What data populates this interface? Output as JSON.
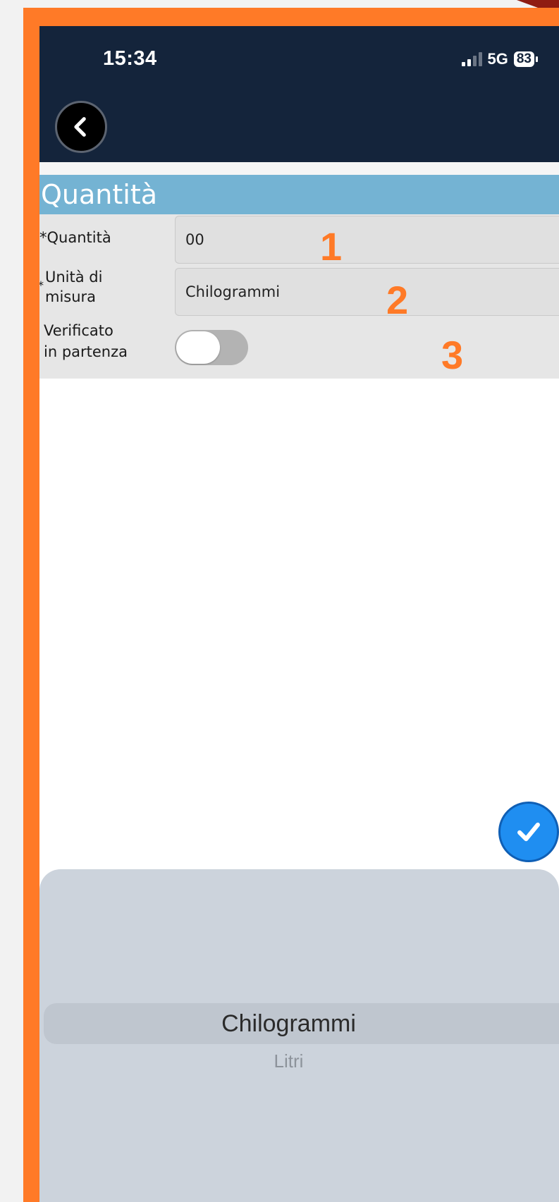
{
  "status_bar": {
    "time": "15:34",
    "network": "5G",
    "battery": "83"
  },
  "icons": {
    "back": "chevron-left-icon",
    "confirm": "checkmark-icon"
  },
  "section": {
    "title": "Quantità"
  },
  "form": {
    "quantity": {
      "label": "*Quantità",
      "value": "00"
    },
    "unit": {
      "label_asterisk": "*",
      "label_line1": "Unità di",
      "label_line2": "misura",
      "value": "Chilogrammi"
    },
    "verified": {
      "label_line1": "Verificato",
      "label_line2": "in partenza",
      "on": false
    }
  },
  "annotations": [
    "1",
    "2",
    "3"
  ],
  "picker": {
    "selected": "Chilogrammi",
    "options": [
      "Litri"
    ]
  },
  "colors": {
    "frame": "#ff7a27",
    "header_bar": "#14243b",
    "section_header": "#74b3d3",
    "confirm_button": "#1f8ef1"
  }
}
